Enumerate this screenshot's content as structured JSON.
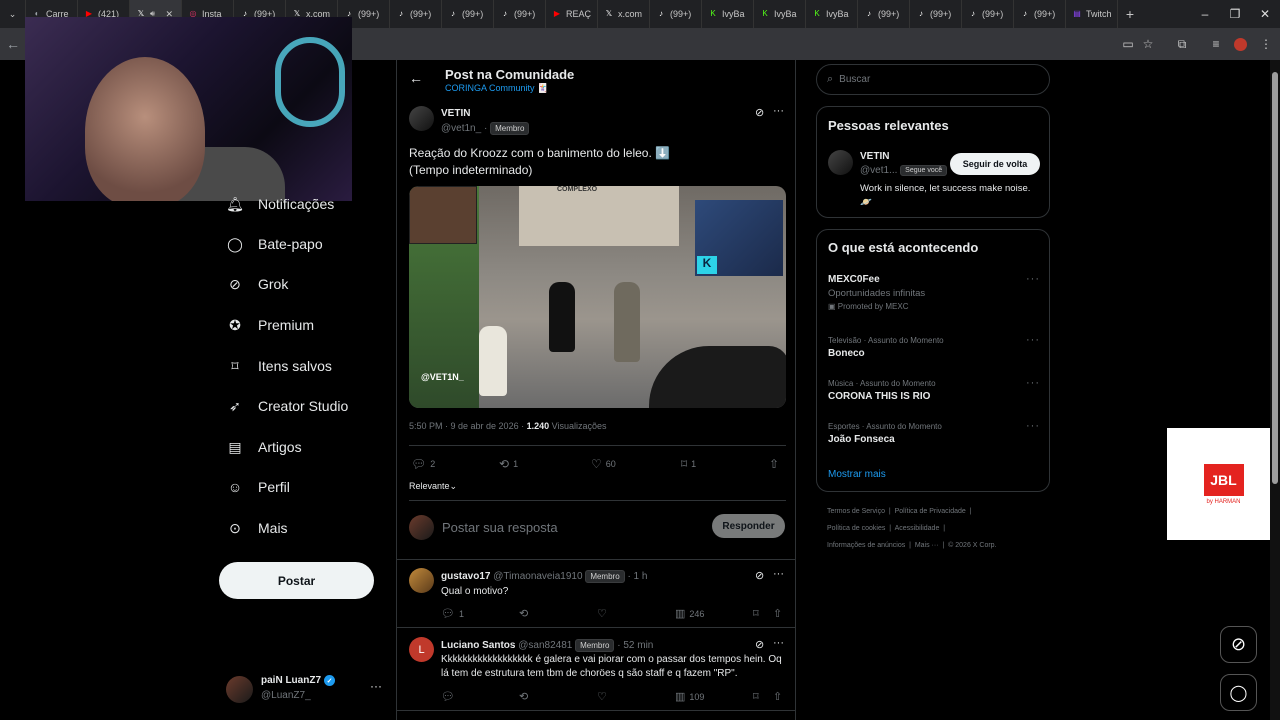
{
  "browser": {
    "tabs": [
      {
        "label": "Carre",
        "icon": "browser-icon",
        "color": "#9aa0a6"
      },
      {
        "label": "(421)",
        "icon": "youtube-icon",
        "color": "#ff0000"
      },
      {
        "label": "",
        "icon": "x-icon",
        "color": "#ffffff",
        "active": true
      },
      {
        "label": "Insta",
        "icon": "instagram-icon",
        "color": "#e1306c"
      },
      {
        "label": "(99+)",
        "icon": "tiktok-icon",
        "color": "#ffffff"
      },
      {
        "label": "x.com",
        "icon": "x-icon",
        "color": "#ffffff"
      },
      {
        "label": "(99+)",
        "icon": "tiktok-icon",
        "color": "#ffffff"
      },
      {
        "label": "(99+)",
        "icon": "tiktok-icon",
        "color": "#ffffff"
      },
      {
        "label": "(99+)",
        "icon": "tiktok-icon",
        "color": "#ffffff"
      },
      {
        "label": "(99+)",
        "icon": "tiktok-icon",
        "color": "#ffffff"
      },
      {
        "label": "REAÇ",
        "icon": "youtube-icon",
        "color": "#ff0000"
      },
      {
        "label": "x.com",
        "icon": "x-icon",
        "color": "#ffffff"
      },
      {
        "label": "(99+)",
        "icon": "tiktok-icon",
        "color": "#ffffff"
      },
      {
        "label": "IvyBa",
        "icon": "kick-icon",
        "color": "#53fc18"
      },
      {
        "label": "IvyBa",
        "icon": "kick-icon",
        "color": "#53fc18"
      },
      {
        "label": "IvyBa",
        "icon": "kick-icon",
        "color": "#53fc18"
      },
      {
        "label": "(99+)",
        "icon": "tiktok-icon",
        "color": "#ffffff"
      },
      {
        "label": "(99+)",
        "icon": "tiktok-icon",
        "color": "#ffffff"
      },
      {
        "label": "(99+)",
        "icon": "tiktok-icon",
        "color": "#ffffff"
      },
      {
        "label": "(99+)",
        "icon": "tiktok-icon",
        "color": "#ffffff"
      },
      {
        "label": "Twitch",
        "icon": "twitch-icon",
        "color": "#9146ff"
      }
    ]
  },
  "nav": {
    "items": [
      {
        "label": "Notificações",
        "icon": "bell-icon"
      },
      {
        "label": "Bate-papo",
        "icon": "chat-icon"
      },
      {
        "label": "Grok",
        "icon": "grok-icon"
      },
      {
        "label": "Premium",
        "icon": "premium-icon"
      },
      {
        "label": "Itens salvos",
        "icon": "bookmark-icon"
      },
      {
        "label": "Creator Studio",
        "icon": "rocket-icon"
      },
      {
        "label": "Artigos",
        "icon": "article-icon"
      },
      {
        "label": "Perfil",
        "icon": "person-icon"
      },
      {
        "label": "Mais",
        "icon": "more-circle-icon"
      }
    ],
    "post_button": "Postar",
    "account": {
      "name": "paiN LuanZ7",
      "handle": "@LuanZ7_"
    }
  },
  "post": {
    "header_title": "Post na Comunidade",
    "community": "CORINGA Community 🃏",
    "author_name": "VETIN",
    "author_handle": "@vet1n_",
    "author_badge": "Membro",
    "text_line1": "Reação do Kroozz com o banimento do leleo. ⬇️",
    "text_line2": "(Tempo indeterminado)",
    "video_watermark": "@VET1N_",
    "video_sign": "COMPLEXO",
    "timestamp": "5:50 PM · 9 de abr de 2026 · ",
    "views_count": "1.240",
    "views_label": "Visualizações",
    "replies": "2",
    "reposts": "1",
    "likes": "60",
    "bookmarks": "1",
    "sort_label": "Relevante",
    "reply_placeholder": "Postar sua resposta",
    "reply_button": "Responder"
  },
  "replies": [
    {
      "name": "gustavo17",
      "handle": "@Timaonaveia1910",
      "badge": "Membro",
      "time": "· 1 h",
      "text": "Qual o motivo?",
      "replies": "1",
      "reposts": "",
      "likes": "",
      "views": "246"
    },
    {
      "name": "Luciano Santos",
      "handle": "@san82481",
      "badge": "Membro",
      "time": "· 52 min",
      "avatar_letter": "L",
      "text1": "Kkkkkkkkkkkkkkkkkk é galera e vai piorar com o passar dos tempos hein. Oq",
      "text2": "lá tem de estrutura tem tbm de choröes q são staff e q fazem \"RP\".",
      "views": "109"
    }
  ],
  "sidebar": {
    "search_placeholder": "Buscar",
    "relevant_title": "Pessoas relevantes",
    "relevant_person": {
      "name": "VETIN",
      "handle": "@vet1...",
      "follows_you": "Segue você",
      "follow_button": "Seguir de volta",
      "bio": "Work in silence, let success make noise. 🪐"
    },
    "happening_title": "O que está acontecendo",
    "promo": {
      "title": "MEXC0Fee",
      "subtitle": "Oportunidades infinitas",
      "promoted": "Promoted by MEXC"
    },
    "trends": [
      {
        "category": "Televisão · Assunto do Momento",
        "name": "Boneco"
      },
      {
        "category": "Música · Assunto do Momento",
        "name": "CORONA THIS IS RIO"
      },
      {
        "category": "Esportes · Assunto do Momento",
        "name": "João Fonseca"
      }
    ],
    "show_more": "Mostrar mais",
    "footer": {
      "terms": "Termos de Serviço",
      "privacy": "Política de Privacidade",
      "cookies": "Política de cookies",
      "accessibility": "Acessibilidade",
      "ads_info": "Informações de anúncios",
      "more": "Mais ···",
      "copyright": "© 2026 X Corp."
    }
  },
  "ad": {
    "logo": "JBL",
    "brand": "by HARMAN"
  },
  "colors": {
    "accent": "#1d9bf0",
    "background": "#000000",
    "border": "#2f3336",
    "muted": "#71767b",
    "verified": "#1d9bf0"
  }
}
